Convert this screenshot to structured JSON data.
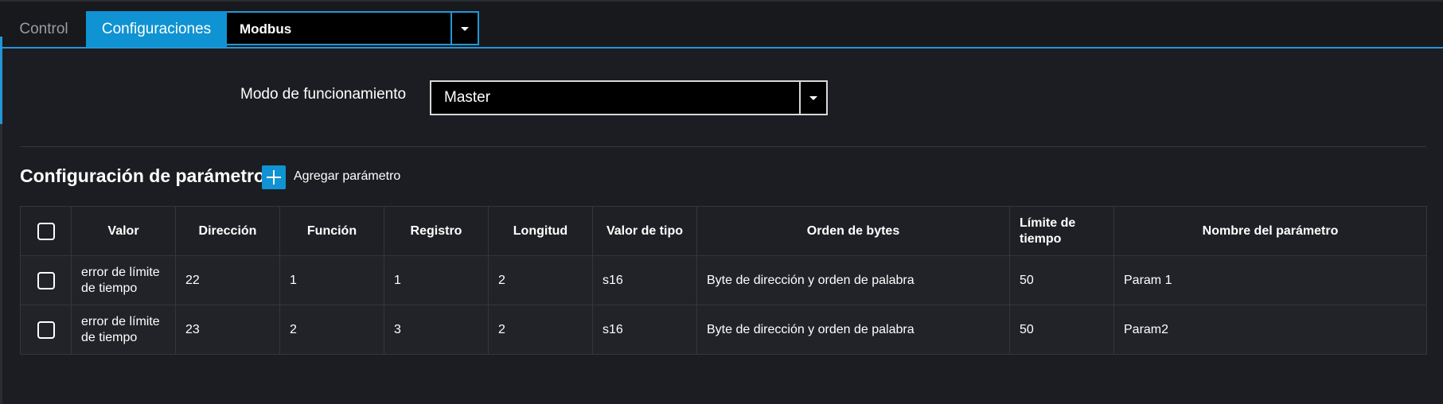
{
  "tabs": {
    "control": "Control",
    "configuraciones": "Configuraciones",
    "protocol_select": "Modbus"
  },
  "mode": {
    "label": "Modo de funcionamiento",
    "value": "Master"
  },
  "params": {
    "title": "Configuración de parámetros",
    "add_label": "Agregar parámetro",
    "headers": {
      "valor": "Valor",
      "direccion": "Dirección",
      "funcion": "Función",
      "registro": "Registro",
      "longitud": "Longitud",
      "valor_tipo": "Valor de tipo",
      "orden_bytes": "Orden de bytes",
      "limite_line1": "Límite de",
      "limite_line2": "tiempo",
      "nombre": "Nombre del parámetro"
    },
    "rows": [
      {
        "valor_line1": "error de límite",
        "valor_line2": "de tiempo",
        "direccion": "22",
        "funcion": "1",
        "registro": "1",
        "longitud": "2",
        "valor_tipo": "s16",
        "orden_bytes": "Byte de dirección y orden de palabra",
        "limite": "50",
        "nombre": "Param 1"
      },
      {
        "valor_line1": "error de límite",
        "valor_line2": "de tiempo",
        "direccion": "23",
        "funcion": "2",
        "registro": "3",
        "longitud": "2",
        "valor_tipo": "s16",
        "orden_bytes": "Byte de dirección y orden de palabra",
        "limite": "50",
        "nombre": "Param2"
      }
    ]
  },
  "colors": {
    "accent": "#0f93d2",
    "background": "#1c1d22"
  },
  "icons": {
    "add": "plus-icon",
    "dropdown": "caret-down-icon",
    "checkbox": "checkbox-icon"
  }
}
